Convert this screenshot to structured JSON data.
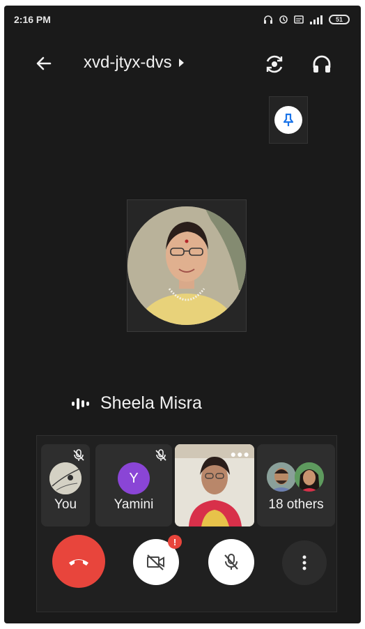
{
  "status_bar": {
    "time": "2:16 PM",
    "battery": "51"
  },
  "header": {
    "meeting_code": "xvd-jtyx-dvs"
  },
  "speaker": {
    "name": "Sheela Misra"
  },
  "participants": [
    {
      "label": "You",
      "muted": true
    },
    {
      "label": "Yamini",
      "initial": "Y",
      "muted": true,
      "avatar_color": "#8a45d6"
    },
    {
      "label": "",
      "video": true
    },
    {
      "label": "18 others"
    }
  ],
  "controls": {
    "camera_alert": "!"
  },
  "colors": {
    "end_call": "#e8453c",
    "pin_icon": "#1a73e8",
    "background": "#1a1a1a"
  }
}
